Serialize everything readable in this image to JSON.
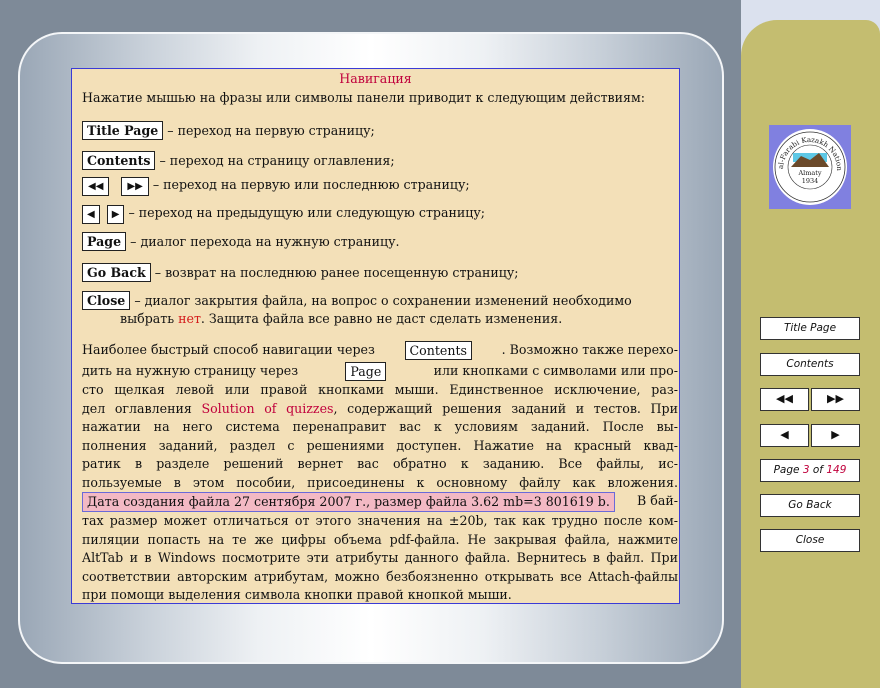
{
  "section_title": "Навигация",
  "intro": "Нажатие мышью на фразы или символы панели приводит к следующим действиям:",
  "items": [
    {
      "btn": "Title Page",
      "desc": "– переход на первую страницу;"
    },
    {
      "btn": "Contents",
      "desc": "– переход на страницу оглавления;"
    },
    {
      "btn_a": "◀◀",
      "btn_b": "▶▶",
      "desc": "– переход на первую или последнюю страницу;"
    },
    {
      "btn_a": "◀",
      "btn_b": "▶",
      "desc": "– переход на предыдущую или следующую страницу;"
    },
    {
      "btn": "Page",
      "desc": "– диалог перехода на нужную страницу."
    },
    {
      "btn": "Go Back",
      "desc": "– возврат на последнюю ранее посещенную страницу;"
    },
    {
      "btn": "Close",
      "desc": "– диалог закрытия файла, на вопрос о сохранении изменений необходимо",
      "desc2_a": "выбрать ",
      "desc2_red": "нет",
      "desc2_b": ". Защита файла все равно не даст сделать изменения."
    }
  ],
  "paragraph": {
    "l1a": "Наиболее быстрый способ навигации через",
    "l1btn": "Contents",
    "l1b": ". Возможно также перехо-",
    "l2a": "дить на нужную страницу через",
    "l2btn": "Page",
    "l2b": "или кнопками с символами или про-",
    "l3": "сто щелкая левой или правой кнопками мыши. Единственное исключение, раз-",
    "l4a": "дел оглавления ",
    "l4link": "Solution of quizzes",
    "l4b": ", содержащий решения заданий и тестов. При",
    "l5": "нажатии на него система перенаправит вас к условиям заданий. После вы-",
    "l6": "полнения заданий, раздел с решениями доступен. Нажатие на красный квад-",
    "l7": "ратик в разделе решений вернет вас обратно к заданию. Все файлы, ис-",
    "l8": "пользуемые в этом пособии, присоединены к основному файлу как вложения.",
    "l9hl": "Дата создания файла 27 сентября 2007 г., размер файла 3.62 mb=3 801619 b.",
    "l9b": "В бай-",
    "l10": "тах размер может отличаться от этого значения на ±20b, так как трудно после ком-",
    "l11": "пиляции попасть на те же цифры объема pdf-файла. Не закрывая файла, нажмите",
    "l12": "AltTab и в Windows посмотрите эти атрибуты данного файла. Вернитесь в файл. При",
    "l13": "соответствии авторским атрибутам, можно безбоязненно открывать все Attach-файлы",
    "l14": "при помощи выделения символа кнопки правой кнопкой мыши."
  },
  "sidebar": {
    "title_page": "Title Page",
    "contents": "Contents",
    "first": "◀◀",
    "last": "▶▶",
    "prev": "◀",
    "next": "▶",
    "page_prefix": "Page",
    "page_current": "3",
    "page_of": "of",
    "page_total": "149",
    "go_back": "Go Back",
    "close": "Close"
  },
  "seal": {
    "text_top": "al-Farabi Kazakh National University",
    "city": "Almaty",
    "year": "1934"
  },
  "colors": {
    "accent_red": "#c0003c",
    "content_bg": "#f3e0b8",
    "sidebar_bg": "#c4bd70"
  }
}
